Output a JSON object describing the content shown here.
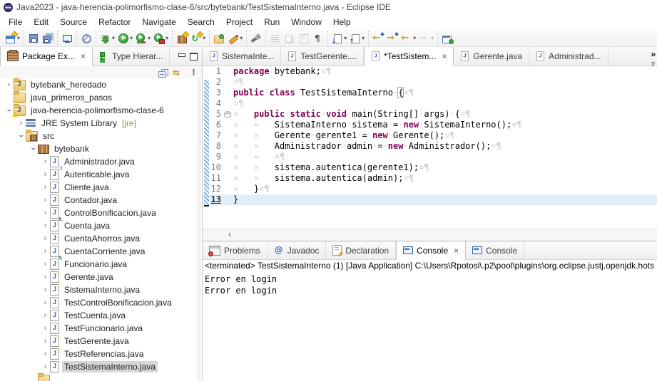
{
  "window": {
    "title": "Java2023 - java-herencia-polimorfismo-clase-6/src/bytebank/TestSistemaInterno.java - Eclipse IDE"
  },
  "menu": {
    "items": [
      "File",
      "Edit",
      "Source",
      "Refactor",
      "Navigate",
      "Search",
      "Project",
      "Run",
      "Window",
      "Help"
    ]
  },
  "toolbar": {
    "groups": [
      {
        "icons": [
          {
            "name": "new-wizard-icon",
            "dd": true
          }
        ]
      },
      {
        "icons": [
          {
            "name": "save-icon"
          },
          {
            "name": "save-all-icon"
          }
        ]
      },
      {
        "icons": [
          {
            "name": "open-console-icon"
          }
        ]
      },
      {
        "icons": [
          {
            "name": "skip-breakpoints-icon"
          }
        ]
      },
      {
        "icons": [
          {
            "name": "debug-icon",
            "dd": true
          },
          {
            "name": "run-icon",
            "dd": true
          },
          {
            "name": "coverage-icon",
            "dd": true
          },
          {
            "name": "profile-icon",
            "dd": true
          }
        ]
      },
      {
        "icons": [
          {
            "name": "new-java-project-icon"
          },
          {
            "name": "update-icon",
            "dd": true
          }
        ]
      },
      {
        "icons": [
          {
            "name": "open-type-icon"
          },
          {
            "name": "mark-occurrences-icon",
            "dd": true
          }
        ]
      },
      {
        "icons": [
          {
            "name": "search-icon"
          }
        ]
      },
      {
        "icons": [
          {
            "name": "format-icon",
            "disabled": true
          },
          {
            "name": "link-editor-icon",
            "disabled": true
          },
          {
            "name": "show-selected-element-icon",
            "disabled": true
          },
          {
            "name": "show-whitespace-icon"
          }
        ]
      },
      {
        "icons": [
          {
            "name": "next-annotation-icon",
            "dd": true
          },
          {
            "name": "previous-annotation-icon",
            "dd": true
          }
        ]
      },
      {
        "icons": [
          {
            "name": "last-edit-location-icon"
          },
          {
            "name": "next-edit-location-icon"
          },
          {
            "name": "back-icon",
            "dd": true
          },
          {
            "name": "forward-icon",
            "dd": true,
            "disabled": true
          }
        ]
      },
      {
        "icons": [
          {
            "name": "pin-editor-icon"
          }
        ]
      }
    ]
  },
  "explorer": {
    "tabs": [
      {
        "label": "Package Ex...",
        "icon": "package-explorer-icon",
        "active": true,
        "close": true
      },
      {
        "label": "Type Hierar...",
        "icon": "type-hierarchy-icon",
        "active": false
      }
    ],
    "window_buttons": [
      {
        "name": "minimize-icon"
      },
      {
        "name": "maximize-icon"
      }
    ],
    "view_toolbar": [
      {
        "name": "collapse-all-icon"
      },
      {
        "name": "link-with-editor-icon"
      },
      {
        "name": "view-menu-icon"
      }
    ],
    "tree": [
      {
        "depth": 0,
        "expander": "collapsed",
        "icon": "java-project",
        "label": "bytebank_heredado"
      },
      {
        "depth": 0,
        "expander": "none",
        "icon": "folder",
        "label": "java_primeros_pasos"
      },
      {
        "depth": 0,
        "expander": "expanded",
        "icon": "java-project",
        "warning": true,
        "label": "java-herencia-polimorfismo-clase-6"
      },
      {
        "depth": 1,
        "expander": "collapsed",
        "icon": "jre-library",
        "label": "JRE System Library",
        "suffix": "[jre]"
      },
      {
        "depth": 1,
        "expander": "expanded",
        "icon": "src-folder",
        "label": "src"
      },
      {
        "depth": 2,
        "expander": "expanded",
        "icon": "package",
        "label": "bytebank"
      },
      {
        "depth": 3,
        "expander": "collapsed",
        "icon": "java-file",
        "label": "Administrador.java"
      },
      {
        "depth": 3,
        "expander": "collapsed",
        "icon": "java-file",
        "badge": "I",
        "label": "Autenticable.java"
      },
      {
        "depth": 3,
        "expander": "collapsed",
        "icon": "java-file",
        "label": "Cliente.java"
      },
      {
        "depth": 3,
        "expander": "collapsed",
        "icon": "java-file",
        "label": "Contador.java"
      },
      {
        "depth": 3,
        "expander": "collapsed",
        "icon": "java-file",
        "label": "ControlBonificacion.java"
      },
      {
        "depth": 3,
        "expander": "collapsed",
        "icon": "java-file",
        "badge": "A",
        "label": "Cuenta.java"
      },
      {
        "depth": 3,
        "expander": "collapsed",
        "icon": "java-file",
        "label": "CuentaAhorros.java"
      },
      {
        "depth": 3,
        "expander": "collapsed",
        "icon": "java-file",
        "label": "CuentaCorriente.java"
      },
      {
        "depth": 3,
        "expander": "collapsed",
        "icon": "java-file",
        "badge": "A",
        "label": "Funcionario.java"
      },
      {
        "depth": 3,
        "expander": "collapsed",
        "icon": "java-file",
        "label": "Gerente.java"
      },
      {
        "depth": 3,
        "expander": "collapsed",
        "icon": "java-file",
        "label": "SistemaInterno.java"
      },
      {
        "depth": 3,
        "expander": "collapsed",
        "icon": "java-file",
        "label": "TestControlBonificacion.java"
      },
      {
        "depth": 3,
        "expander": "collapsed",
        "icon": "java-file",
        "label": "TestCuenta.java"
      },
      {
        "depth": 3,
        "expander": "collapsed",
        "icon": "java-file",
        "label": "TestFuncionario.java"
      },
      {
        "depth": 3,
        "expander": "collapsed",
        "icon": "java-file",
        "label": "TestGerente.java"
      },
      {
        "depth": 3,
        "expander": "collapsed",
        "icon": "java-file",
        "label": "TestReferencias.java"
      },
      {
        "depth": 3,
        "expander": "collapsed",
        "icon": "java-file",
        "label": "TestSistemaInterno.java",
        "selected": true
      },
      {
        "depth": 2,
        "expander": "none",
        "icon": "folder",
        "label": "",
        "partial": true
      }
    ]
  },
  "editor": {
    "tabs": [
      {
        "label": "SistemaInte...",
        "active": false
      },
      {
        "label": "TestGerente....",
        "active": false
      },
      {
        "label": "*TestSistem...",
        "active": true,
        "close": true
      },
      {
        "label": "Gerente.java",
        "active": false
      },
      {
        "label": "Administrad...",
        "active": false
      }
    ],
    "overflow_count": "2",
    "current_line": 13,
    "lines": [
      {
        "n": 1,
        "seg": [
          [
            "k",
            "package"
          ],
          [
            "w",
            "·"
          ],
          [
            "p",
            "bytebank;"
          ],
          [
            "w",
            "¤¶"
          ]
        ]
      },
      {
        "n": 2,
        "seg": [
          [
            "w",
            "¤¶"
          ]
        ]
      },
      {
        "n": 3,
        "seg": [
          [
            "k",
            "public"
          ],
          [
            "w",
            "·"
          ],
          [
            "k",
            "class"
          ],
          [
            "w",
            "·"
          ],
          [
            "p",
            "TestSistemaInterno"
          ],
          [
            "w",
            "·"
          ],
          [
            "b",
            "{"
          ],
          [
            "w",
            "¤¶"
          ]
        ]
      },
      {
        "n": 4,
        "seg": [
          [
            "w",
            "¤¶"
          ]
        ]
      },
      {
        "n": 5,
        "fold": true,
        "seg": [
          [
            "w",
            "»   "
          ],
          [
            "k",
            "public"
          ],
          [
            "w",
            "·"
          ],
          [
            "k",
            "static"
          ],
          [
            "w",
            "·"
          ],
          [
            "k",
            "void"
          ],
          [
            "w",
            "·"
          ],
          [
            "p",
            "main(String[]"
          ],
          [
            "w",
            "·"
          ],
          [
            "p",
            "args)"
          ],
          [
            "w",
            "·"
          ],
          [
            "p",
            "{"
          ],
          [
            "w",
            "¤¶"
          ]
        ]
      },
      {
        "n": 6,
        "seg": [
          [
            "w",
            "»   »   "
          ],
          [
            "p",
            "SistemaInterno"
          ],
          [
            "w",
            "·"
          ],
          [
            "p",
            "sistema"
          ],
          [
            "w",
            "·"
          ],
          [
            "p",
            "="
          ],
          [
            "w",
            "·"
          ],
          [
            "k",
            "new"
          ],
          [
            "w",
            "·"
          ],
          [
            "p",
            "SistemaInterno();"
          ],
          [
            "w",
            "¤¶"
          ]
        ]
      },
      {
        "n": 7,
        "seg": [
          [
            "w",
            "»   »   "
          ],
          [
            "p",
            "Gerente"
          ],
          [
            "w",
            "·"
          ],
          [
            "p",
            "gerente1"
          ],
          [
            "w",
            "·"
          ],
          [
            "p",
            "="
          ],
          [
            "w",
            "·"
          ],
          [
            "k",
            "new"
          ],
          [
            "w",
            "·"
          ],
          [
            "p",
            "Gerente();"
          ],
          [
            "w",
            "¤¶"
          ]
        ]
      },
      {
        "n": 8,
        "seg": [
          [
            "w",
            "»   »   "
          ],
          [
            "p",
            "Administrador"
          ],
          [
            "w",
            "·"
          ],
          [
            "p",
            "admin"
          ],
          [
            "w",
            "·"
          ],
          [
            "p",
            "="
          ],
          [
            "w",
            "·"
          ],
          [
            "k",
            "new"
          ],
          [
            "w",
            "·"
          ],
          [
            "p",
            "Administrador();"
          ],
          [
            "w",
            "¤¶"
          ]
        ]
      },
      {
        "n": 9,
        "seg": [
          [
            "w",
            "»   »   ¤¶"
          ]
        ]
      },
      {
        "n": 10,
        "seg": [
          [
            "w",
            "»   »   "
          ],
          [
            "p",
            "sistema.autentica(gerente1);"
          ],
          [
            "w",
            "¤¶"
          ]
        ]
      },
      {
        "n": 11,
        "seg": [
          [
            "w",
            "»   »   "
          ],
          [
            "p",
            "sistema.autentica(admin);"
          ],
          [
            "w",
            "¤¶"
          ]
        ]
      },
      {
        "n": 12,
        "seg": [
          [
            "w",
            "»   "
          ],
          [
            "p",
            "}"
          ],
          [
            "w",
            "¤¶"
          ]
        ]
      },
      {
        "n": 13,
        "seg": [
          [
            "p",
            "}"
          ]
        ]
      }
    ]
  },
  "console": {
    "tabs": [
      {
        "label": "Problems",
        "icon": "problems-icon"
      },
      {
        "label": "Javadoc",
        "icon": "javadoc-icon"
      },
      {
        "label": "Declaration",
        "icon": "declaration-icon"
      },
      {
        "label": "Console",
        "icon": "console-icon",
        "active": true,
        "close": true
      },
      {
        "label": "Console",
        "icon": "console-icon"
      }
    ],
    "status": "<terminated> TestSistemaInterno (1) [Java Application] C:\\Users\\Rpotosi\\.p2\\pool\\plugins\\org.eclipse.justj.openjdk.hots",
    "output": [
      "Error en login",
      "Error en login"
    ]
  },
  "colors": {
    "keyword": "#7f0055",
    "whitespace_marks": "#c3ccd4",
    "current_line": "#e2edfa",
    "tree_selection": "#d6d6d6",
    "quickdiff": "#7fb2dd"
  }
}
